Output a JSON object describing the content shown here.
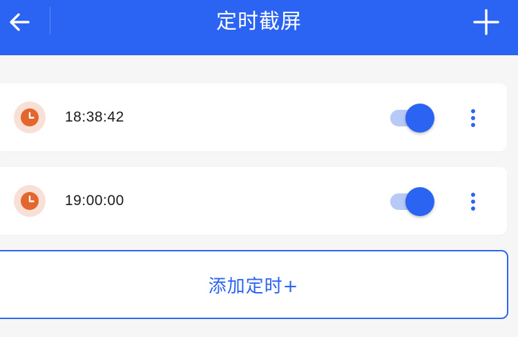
{
  "colors": {
    "primary": "#2b63f2",
    "toggle_track": "#b6c9f7",
    "clock_orange": "#e2662e",
    "clock_bg": "#f9e0d6",
    "page_bg": "#f6f6f6"
  },
  "header": {
    "title": "定时截屏",
    "back_icon": "arrow-left-icon",
    "add_icon": "plus-icon"
  },
  "timers": [
    {
      "time": "18:38:42",
      "enabled": true,
      "icon": "clock-icon"
    },
    {
      "time": "19:00:00",
      "enabled": true,
      "icon": "clock-icon"
    }
  ],
  "add_timer_label": "添加定时+"
}
